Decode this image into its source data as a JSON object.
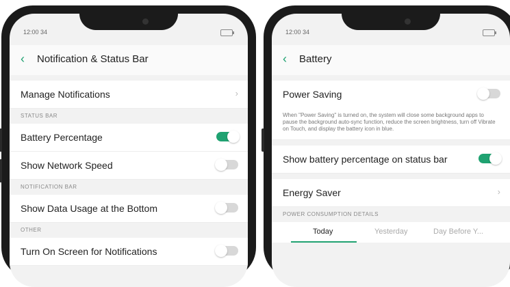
{
  "left": {
    "status": {
      "time": "12:00 34"
    },
    "header": {
      "back": "‹",
      "title": "Notification & Status Bar"
    },
    "manage_notifications": {
      "label": "Manage Notifications",
      "chevron": "›"
    },
    "sections": {
      "status_bar": "STATUS BAR",
      "notification_bar": "NOTIFICATION BAR",
      "other": "OTHER"
    },
    "battery_percentage": {
      "label": "Battery Percentage",
      "on": true
    },
    "network_speed": {
      "label": "Show Network Speed",
      "on": false
    },
    "data_usage": {
      "label": "Show Data Usage at the Bottom",
      "on": false
    },
    "turn_on_screen": {
      "label": "Turn On Screen for Notifications",
      "on": false
    }
  },
  "right": {
    "status": {
      "time": "12:00 34"
    },
    "header": {
      "back": "‹",
      "title": "Battery"
    },
    "power_saving": {
      "label": "Power Saving",
      "on": false
    },
    "power_saving_desc": "When \"Power Saving\" is turned on, the system will close some background apps to pause the background auto-sync function, reduce the screen brightness, turn off Vibrate on Touch, and display the battery icon in blue.",
    "battery_percentage_status_bar": {
      "label": "Show battery percentage on status bar",
      "on": true
    },
    "energy_saver": {
      "label": "Energy Saver",
      "chevron": "›"
    },
    "section_power_details": "POWER CONSUMPTION DETAILS",
    "tabs": [
      "Today",
      "Yesterday",
      "Day Before Y..."
    ]
  },
  "colors": {
    "accent": "#1fa271",
    "bezel": "#1b1b1b",
    "background": "#f2f2f2"
  }
}
